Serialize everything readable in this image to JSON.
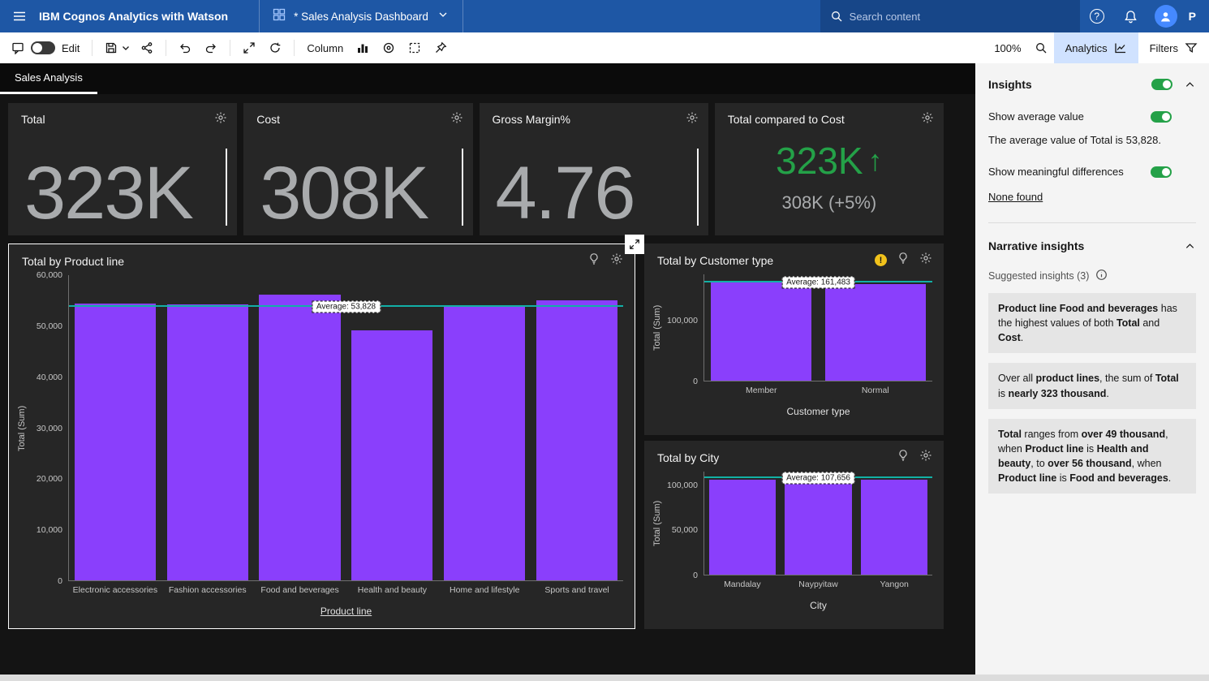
{
  "topbar": {
    "brand": "IBM Cognos Analytics with Watson",
    "document_title": "* Sales Analysis Dashboard",
    "search_placeholder": "Search content",
    "profile_initial": "P"
  },
  "toolbar": {
    "edit_label": "Edit",
    "column_label": "Column",
    "zoom_level": "100%",
    "analytics_label": "Analytics",
    "filters_label": "Filters"
  },
  "sheet_tabs": [
    {
      "label": "Sales Analysis"
    }
  ],
  "kpis": [
    {
      "title": "Total",
      "value": "323K"
    },
    {
      "title": "Cost",
      "value": "308K"
    },
    {
      "title": "Gross Margin%",
      "value": "4.76"
    },
    {
      "title": "Total compared to Cost",
      "value": "323K",
      "trend_arrow": "↑",
      "secondary": "308K (+5%)"
    }
  ],
  "chart_data": [
    {
      "type": "bar",
      "title": "Total by Product line",
      "xlabel": "Product line",
      "ylabel": "Total (Sum)",
      "categories": [
        "Electronic accessories",
        "Fashion accessories",
        "Food and beverages",
        "Health and beauty",
        "Home and lifestyle",
        "Sports and travel"
      ],
      "values": [
        54338,
        54306,
        56145,
        49194,
        53862,
        55123
      ],
      "ylim": [
        0,
        60000
      ],
      "yticks": [
        {
          "value": 0,
          "label": "0"
        },
        {
          "value": 10000,
          "label": "10,000"
        },
        {
          "value": 20000,
          "label": "20,000"
        },
        {
          "value": 30000,
          "label": "30,000"
        },
        {
          "value": 40000,
          "label": "40,000"
        },
        {
          "value": 50000,
          "label": "50,000"
        },
        {
          "value": 60000,
          "label": "60,000"
        }
      ],
      "average": 53828,
      "average_label": "Average: 53,828",
      "bar_color": "#8a3ffc",
      "grid": false,
      "legend": false
    },
    {
      "type": "bar",
      "title": "Total by Customer type",
      "xlabel": "Customer type",
      "ylabel": "Total (Sum)",
      "categories": [
        "Member",
        "Normal"
      ],
      "values": [
        164223,
        158743
      ],
      "ylim": [
        0,
        175000
      ],
      "yticks": [
        {
          "value": 0,
          "label": "0"
        },
        {
          "value": 100000,
          "label": "100,000"
        }
      ],
      "average": 161483,
      "average_label": "Average: 161,483",
      "bar_color": "#8a3ffc",
      "grid": false,
      "legend": false
    },
    {
      "type": "bar",
      "title": "Total by City",
      "xlabel": "City",
      "ylabel": "Total (Sum)",
      "categories": [
        "Mandalay",
        "Naypyitaw",
        "Yangon"
      ],
      "values": [
        106198,
        110569,
        106200
      ],
      "ylim": [
        0,
        115000
      ],
      "yticks": [
        {
          "value": 0,
          "label": "0"
        },
        {
          "value": 50000,
          "label": "50,000"
        },
        {
          "value": 100000,
          "label": "100,000"
        }
      ],
      "average": 107656,
      "average_label": "Average: 107,656",
      "bar_color": "#8a3ffc",
      "grid": false,
      "legend": false
    }
  ],
  "insights": {
    "title": "Insights",
    "show_average_label": "Show average value",
    "average_note": "The average value of Total is 53,828.",
    "show_meaningful_label": "Show meaningful differences",
    "none_found_label": "None found",
    "narrative_title": "Narrative insights",
    "suggested_label": "Suggested insights (3)",
    "cards": [
      {
        "segments": [
          {
            "t": "Product line Food and beverages",
            "b": true
          },
          {
            "t": " has the highest values of both ",
            "b": false
          },
          {
            "t": "Total",
            "b": true
          },
          {
            "t": " and ",
            "b": false
          },
          {
            "t": "Cost",
            "b": true
          },
          {
            "t": ".",
            "b": false
          }
        ]
      },
      {
        "segments": [
          {
            "t": "Over all ",
            "b": false
          },
          {
            "t": "product lines",
            "b": true
          },
          {
            "t": ", the sum of ",
            "b": false
          },
          {
            "t": "Total",
            "b": true
          },
          {
            "t": " is ",
            "b": false
          },
          {
            "t": "nearly 323 thousand",
            "b": true
          },
          {
            "t": ".",
            "b": false
          }
        ]
      },
      {
        "segments": [
          {
            "t": "Total",
            "b": true
          },
          {
            "t": " ranges from ",
            "b": false
          },
          {
            "t": "over 49 thousand",
            "b": true
          },
          {
            "t": ", when ",
            "b": false
          },
          {
            "t": "Product line",
            "b": true
          },
          {
            "t": " is ",
            "b": false
          },
          {
            "t": "Health and beauty",
            "b": true
          },
          {
            "t": ", to ",
            "b": false
          },
          {
            "t": "over 56 thousand",
            "b": true
          },
          {
            "t": ", when ",
            "b": false
          },
          {
            "t": "Product line",
            "b": true
          },
          {
            "t": " is ",
            "b": false
          },
          {
            "t": "Food and beverages",
            "b": true
          },
          {
            "t": ".",
            "b": false
          }
        ]
      }
    ]
  },
  "colors": {
    "topbar_blue": "#1e57a5",
    "analytics_chip_bg": "#d0e2ff",
    "bar_purple": "#8a3ffc",
    "average_teal": "#12b0a6",
    "kpi_green": "#24a148",
    "toggle_green": "#24a148",
    "warning_yellow": "#f1c21b",
    "canvas_bg": "#141414",
    "card_bg": "#262626",
    "panel_bg": "#f4f4f4"
  }
}
